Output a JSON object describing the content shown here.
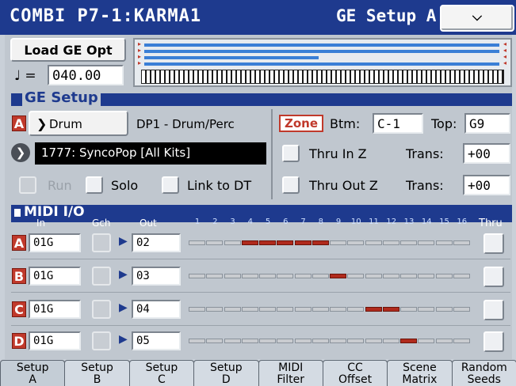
{
  "header": {
    "title": "COMBI  P7-1:KARMA1",
    "page": "GE Setup A",
    "menu_icon": "chevron-down-icon"
  },
  "top": {
    "load_button": "Load GE Opt",
    "tempo_symbol": "♩ =",
    "tempo_value": "040.00"
  },
  "ge_setup": {
    "title": "GE Setup",
    "slot_letter": "A",
    "category_button": "Drum",
    "ge_name": "DP1 - Drum/Perc",
    "preset": "1777: SyncoPop [All Kits]",
    "run_label": "Run",
    "solo_label": "Solo",
    "link_label": "Link to DT",
    "zone_label": "Zone",
    "btm_label": "Btm:",
    "btm_value": "C-1",
    "top_label": "Top:",
    "top_value": "G9",
    "thru_in_label": "Thru In Z",
    "thru_out_label": "Thru Out Z",
    "trans_label": "Trans:",
    "trans_in_value": "+00",
    "trans_out_value": "+00"
  },
  "midi_io": {
    "title": "MIDI I/O",
    "col_in": "In",
    "col_gch": "Gch",
    "col_out": "Out",
    "col_thru": "Thru",
    "channels": [
      "1",
      "2",
      "3",
      "4",
      "5",
      "6",
      "7",
      "8",
      "9",
      "10",
      "11",
      "12",
      "13",
      "14",
      "15",
      "16"
    ],
    "rows": [
      {
        "letter": "A",
        "in": "01G",
        "out": "02",
        "active": [
          4,
          5,
          6,
          7,
          8
        ]
      },
      {
        "letter": "B",
        "in": "01G",
        "out": "03",
        "active": [
          9
        ]
      },
      {
        "letter": "C",
        "in": "01G",
        "out": "04",
        "active": [
          11,
          12
        ]
      },
      {
        "letter": "D",
        "in": "01G",
        "out": "05",
        "active": [
          13
        ]
      }
    ]
  },
  "tabs": [
    {
      "line1": "Setup",
      "line2": "A"
    },
    {
      "line1": "Setup",
      "line2": "B"
    },
    {
      "line1": "Setup",
      "line2": "C"
    },
    {
      "line1": "Setup",
      "line2": "D"
    },
    {
      "line1": "MIDI",
      "line2": "Filter"
    },
    {
      "line1": "CC",
      "line2": "Offset"
    },
    {
      "line1": "Scene",
      "line2": "Matrix"
    },
    {
      "line1": "Random",
      "line2": "Seeds"
    }
  ],
  "colors": {
    "accent": "#1e3a8e",
    "active_segment": "#b02a1c",
    "inactive_segment": "#c9ccd0",
    "slot_letter": "#c0392b"
  }
}
